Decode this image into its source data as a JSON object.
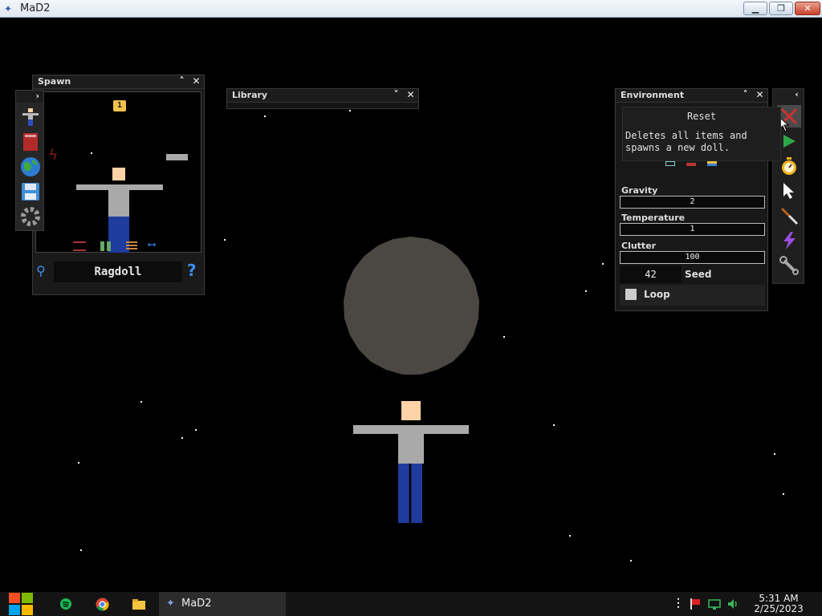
{
  "window": {
    "title": "MaD2",
    "minimize_icon": "minimize-icon",
    "restore_icon": "restore-icon",
    "close_icon": "close-icon"
  },
  "spawn_panel": {
    "title": "Spawn",
    "count_badge": "1",
    "selected_item": "Ragdoll",
    "help_label": "?",
    "side_icons": [
      "ragdoll-icon",
      "book-icon",
      "globe-icon",
      "save-icon",
      "gear-icon"
    ]
  },
  "library_panel": {
    "title": "Library"
  },
  "environment_panel": {
    "title": "Environment",
    "tooltip": {
      "title": "Reset",
      "body": "Deletes all items and spawns a new doll."
    },
    "gravity_label": "Gravity",
    "gravity_value": "2",
    "temperature_label": "Temperature",
    "temperature_value": "1",
    "clutter_label": "Clutter",
    "clutter_value": "100",
    "seed_value": "42",
    "seed_label": "Seed",
    "loop_label": "Loop",
    "loop_checked": false
  },
  "tools": [
    "reset-icon",
    "play-icon",
    "stopwatch-icon",
    "cursor-icon",
    "knife-icon",
    "lightning-icon",
    "wrench-icon"
  ],
  "taskbar": {
    "app_label": "MaD2",
    "time": "5:31 AM",
    "date": "2/25/2023"
  },
  "colors": {
    "skin": "#ffd3a6",
    "shirt": "#a9a9a9",
    "pants": "#1f3b9e",
    "boulder": "#4b4844",
    "badge": "#f1c14b"
  }
}
